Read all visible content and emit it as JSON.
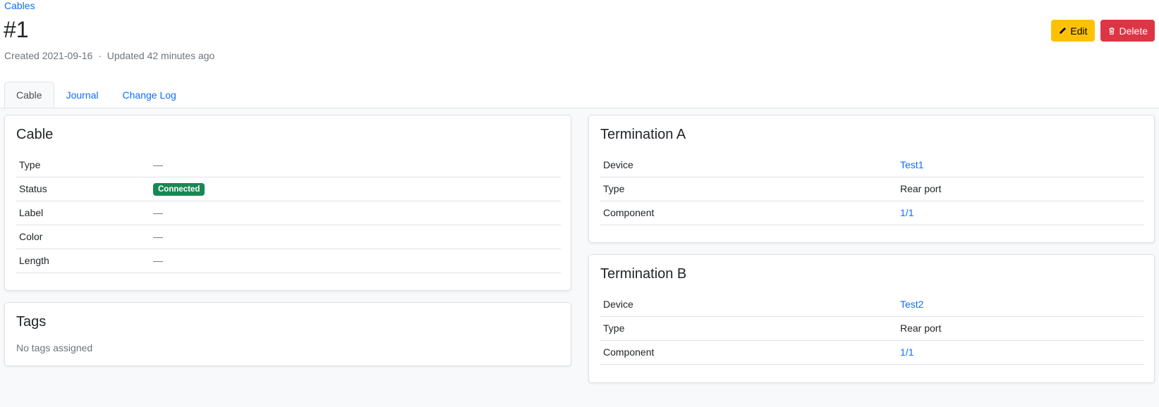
{
  "breadcrumb": "Cables",
  "title": "#1",
  "meta": {
    "created": "Created 2021-09-16",
    "separator": "·",
    "updated": "Updated 42 minutes ago"
  },
  "actions": {
    "edit_label": "Edit",
    "delete_label": "Delete"
  },
  "tabs": [
    {
      "label": "Cable",
      "active": true
    },
    {
      "label": "Journal",
      "active": false
    },
    {
      "label": "Change Log",
      "active": false
    }
  ],
  "cable_card": {
    "title": "Cable",
    "rows": [
      {
        "label": "Type",
        "value": "—"
      },
      {
        "label": "Status",
        "value": "Connected"
      },
      {
        "label": "Label",
        "value": "—"
      },
      {
        "label": "Color",
        "value": "—"
      },
      {
        "label": "Length",
        "value": "—"
      }
    ]
  },
  "tags_card": {
    "title": "Tags",
    "empty_text": "No tags assigned"
  },
  "termination_a": {
    "title": "Termination A",
    "rows": [
      {
        "label": "Device",
        "value": "Test1"
      },
      {
        "label": "Type",
        "value": "Rear port"
      },
      {
        "label": "Component",
        "value": "1/1"
      }
    ]
  },
  "termination_b": {
    "title": "Termination B",
    "rows": [
      {
        "label": "Device",
        "value": "Test2"
      },
      {
        "label": "Type",
        "value": "Rear port"
      },
      {
        "label": "Component",
        "value": "1/1"
      }
    ]
  },
  "colors": {
    "link": "#0d6efd",
    "edit_button": "#ffc107",
    "delete_button": "#dc3545",
    "status_connected": "#198754"
  },
  "icons": {
    "edit": "pencil-icon",
    "delete": "trash-icon"
  }
}
